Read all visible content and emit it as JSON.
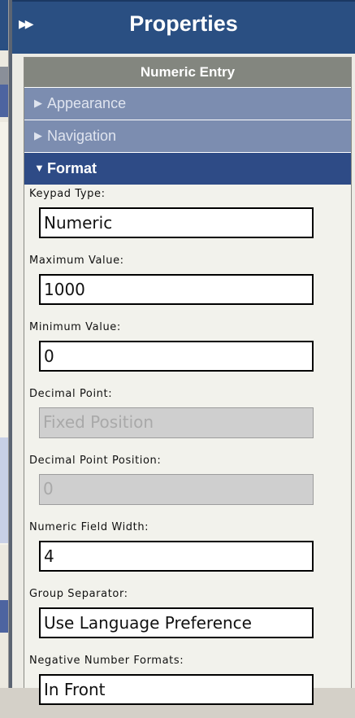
{
  "panel": {
    "title": "Properties",
    "collapse_icon": "double-chevron-right-icon",
    "object_name": "Numeric Entry"
  },
  "sections": [
    {
      "label": "Appearance",
      "expanded": false,
      "icon": "triangle-right-icon"
    },
    {
      "label": "Navigation",
      "expanded": false,
      "icon": "triangle-right-icon"
    },
    {
      "label": "Format",
      "expanded": true,
      "icon": "triangle-down-icon"
    }
  ],
  "fields": [
    {
      "label": "Keypad Type:",
      "value": "Numeric",
      "enabled": true
    },
    {
      "label": "Maximum Value:",
      "value": "1000",
      "enabled": true
    },
    {
      "label": "Minimum Value:",
      "value": "0",
      "enabled": true
    },
    {
      "label": "Decimal Point:",
      "value": "Fixed Position",
      "enabled": false
    },
    {
      "label": "Decimal Point Position:",
      "value": "0",
      "enabled": false
    },
    {
      "label": "Numeric Field Width:",
      "value": "4",
      "enabled": true
    },
    {
      "label": "Group Separator:",
      "value": "Use Language Preference",
      "enabled": true
    },
    {
      "label": "Negative Number Formats:",
      "value": "In Front",
      "enabled": true
    }
  ],
  "colors": {
    "titlebar": "#2a4f82",
    "section_collapsed": "#7c8db0",
    "section_expanded": "#2e4b86",
    "header_gray": "#83867f"
  }
}
